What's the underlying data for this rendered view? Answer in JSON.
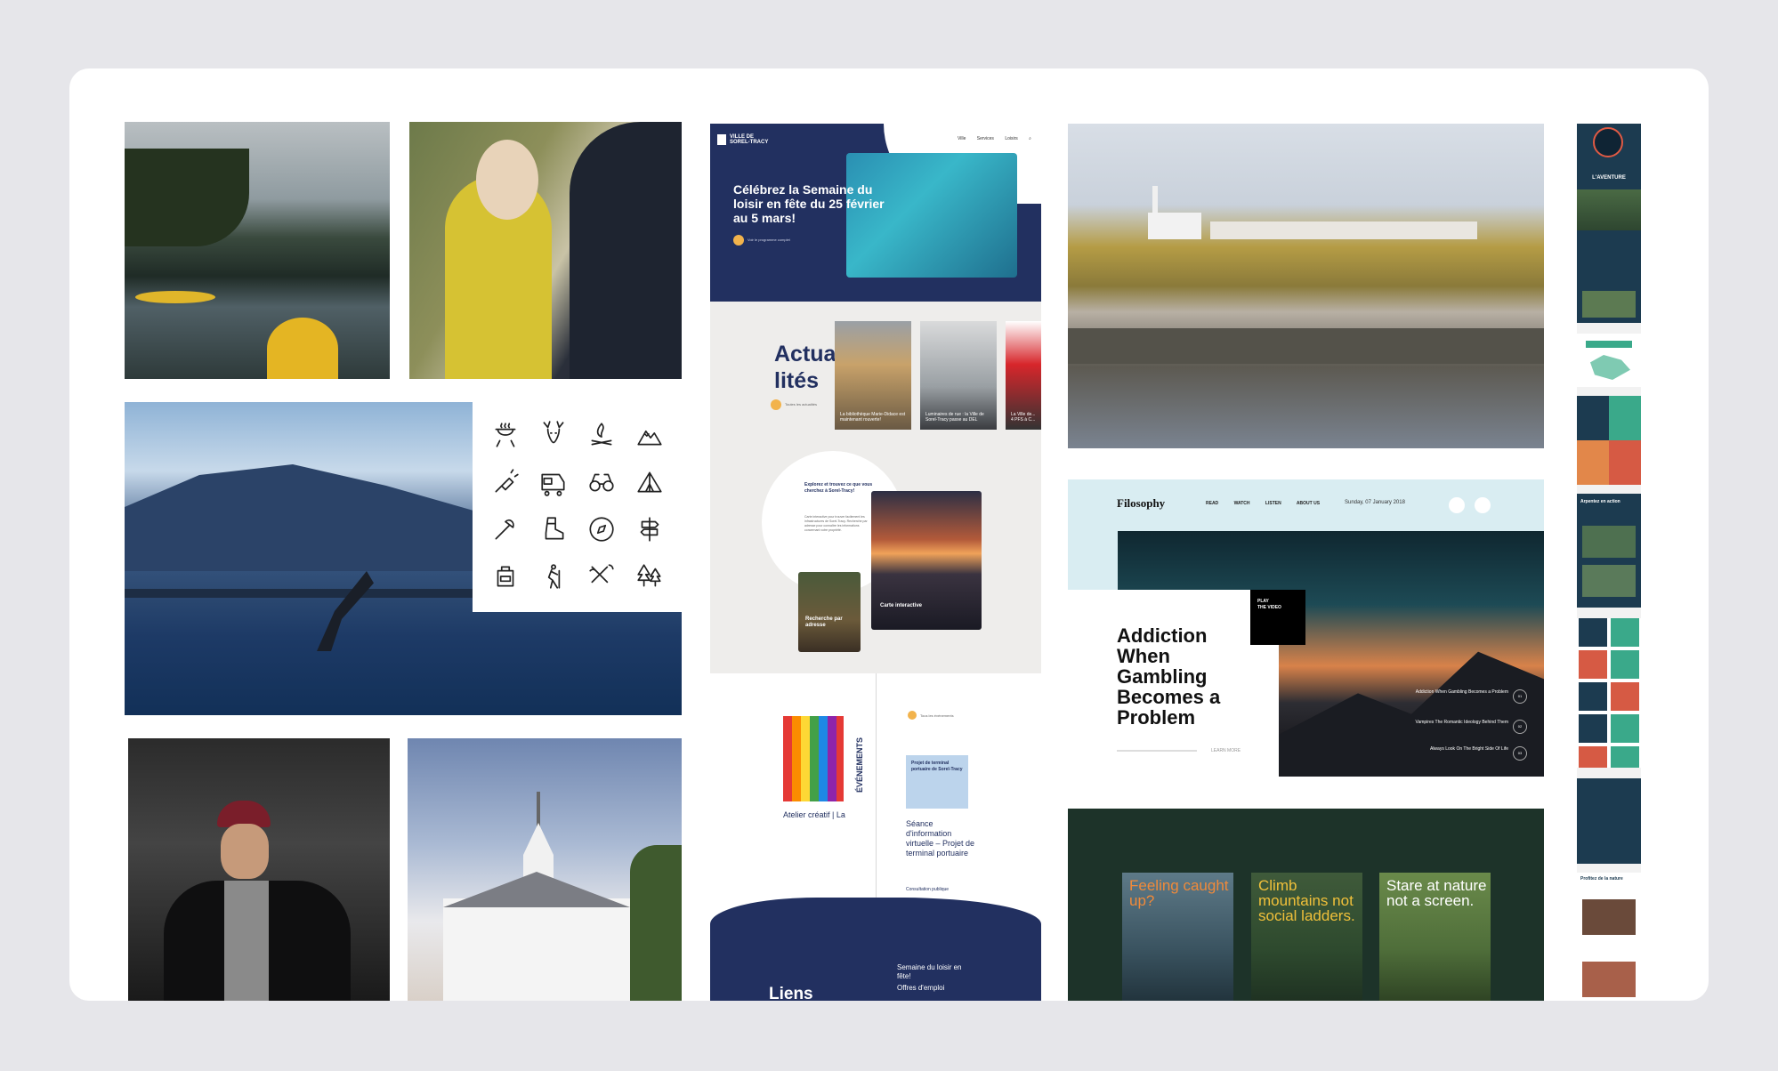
{
  "colors": {
    "page_background": "#e6e6ea",
    "board": "#ffffff",
    "sorel_navy": "#223060",
    "sorel_accent": "#f2b34c",
    "green_panel": "#1d3329",
    "filo_band": "#d9edf2"
  },
  "icons_panel": {
    "icons": [
      "grill-icon",
      "deer-icon",
      "campfire-icon",
      "mountain-icon",
      "flashlight-icon",
      "camper-icon",
      "binoculars-icon",
      "tent-icon",
      "axe-icon",
      "boot-icon",
      "compass-icon",
      "signpost-icon",
      "backpack-icon",
      "hiker-icon",
      "utensils-icon",
      "trees-icon"
    ]
  },
  "sorel": {
    "logo_top": "VILLE DE",
    "logo_bottom": "SOREL-TRACY",
    "nav": [
      "Ville",
      "Services",
      "Loisirs"
    ],
    "hero_title": "Célébrez la Semaine du loisir en fête du 25 février au 5 mars!",
    "hero_cta": "Voir le programme complet",
    "news_title": "Actua-\nlités",
    "news_link": "Toutes les actualités",
    "news_cards": [
      "La bibliothèque Marie-Didace est maintenant rouverte!",
      "Luminaires de rue : la Ville de Sorel-Tracy passe au DEL",
      "La Ville de... 4 PFS à C..."
    ],
    "explore_title": "Explorez et trouvez ce que vous cherchez à Sorel-Tracy!",
    "explore_body": "Carte interactive pour trouver facilement les infrastructures de Sorel-Tracy. Recherche par adresse pour connaître les informations concernant votre propriété.",
    "carte": "Carte interactive",
    "recherche": "Recherche par adresse",
    "events_title": "ÉVÉNEMENTS",
    "events_link": "Tous les événements",
    "pencils_caption": "Atelier créatif | La",
    "port_title": "Projet de terminal portuaire de Sorel-Tracy",
    "seance": "Séance d'information virtuelle – Projet de terminal portuaire",
    "seance_link": "Consultation publique",
    "liens": "Liens",
    "footer_links": [
      "Semaine du loisir en fête!",
      "Offres d'emploi"
    ]
  },
  "filo": {
    "logo": "Filosophy",
    "nav": [
      "READ",
      "WATCH",
      "LISTEN",
      "ABOUT US"
    ],
    "date": "Sunday, 07 January 2018",
    "play": "PLAY\nTHE VIDEO",
    "headline": "Addiction When Gambling Becomes a Problem",
    "learn_more": "LEARN MORE",
    "list": [
      {
        "title": "Addiction When Gambling Becomes a Problem",
        "num": "01"
      },
      {
        "title": "Vampires The Romantic Ideology Behind Them",
        "num": "02"
      },
      {
        "title": "Always Look On The Bright Side Of Life",
        "num": "03"
      }
    ]
  },
  "green": {
    "posters": [
      {
        "text": "Feeling caught up?",
        "color": "#f08a3a"
      },
      {
        "text": "Climb mountains not social ladders.",
        "color": "#f0c03a"
      },
      {
        "text": "Stare at nature not a screen.",
        "color": "#ffffff"
      }
    ]
  },
  "mobile": {
    "title": "L'AVENTURE",
    "section1": "Arpentez en action",
    "section2": "Profitez de la nature"
  }
}
